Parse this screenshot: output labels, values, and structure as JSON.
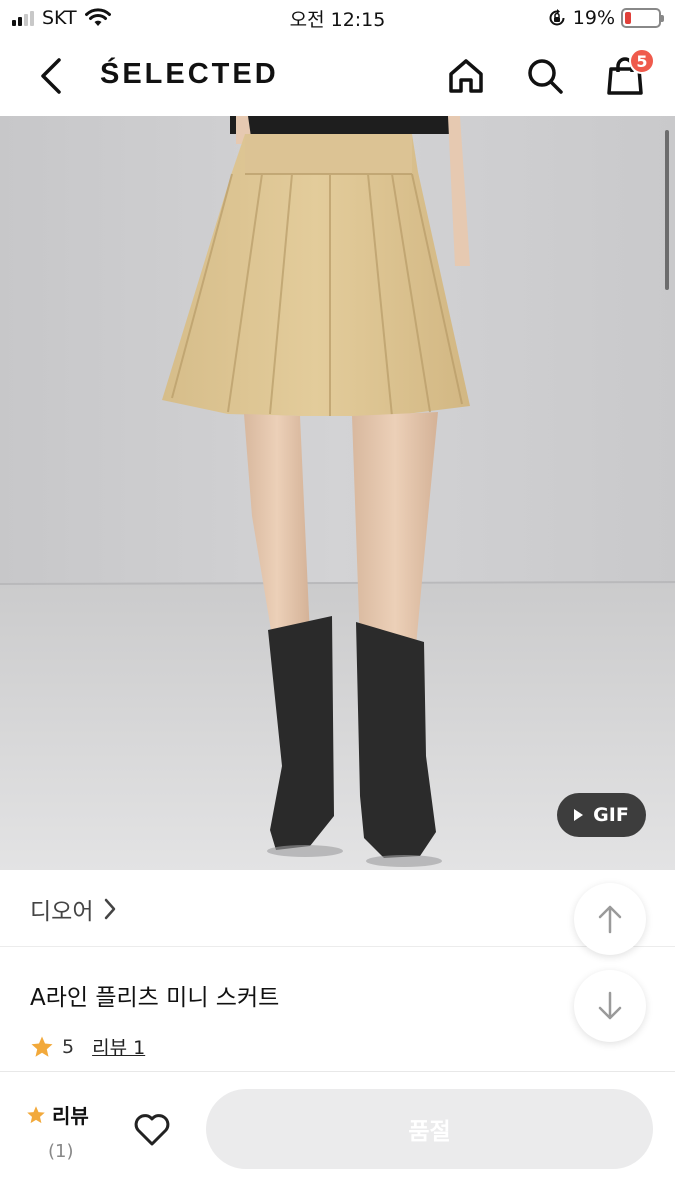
{
  "status_bar": {
    "carrier": "SKT",
    "time": "오전 12:15",
    "battery_text": "19%",
    "battery_level": 0.19,
    "battery_color": "#e0403a"
  },
  "header": {
    "brand": "ŚELECTED",
    "back_icon": "chevron-left-icon",
    "home_icon": "home-icon",
    "search_icon": "search-icon",
    "cart_icon": "shopping-bag-icon",
    "cart_count": "5",
    "badge_color": "#ef5a4c"
  },
  "product": {
    "image_description_icon": "product-photo",
    "gif_label": "GIF",
    "brand_name": "디오어",
    "title": "A라인 플리츠 미니 스커트",
    "rating": "5",
    "review_link": "리뷰 1",
    "star_color": "#f2a93b"
  },
  "fabs": {
    "scroll_up_icon": "arrow-up-icon",
    "scroll_down_icon": "arrow-down-icon"
  },
  "bottom_bar": {
    "review_label": "리뷰",
    "review_count": "(1)",
    "wishlist_icon": "heart-icon",
    "buy_button_label": "품절"
  }
}
